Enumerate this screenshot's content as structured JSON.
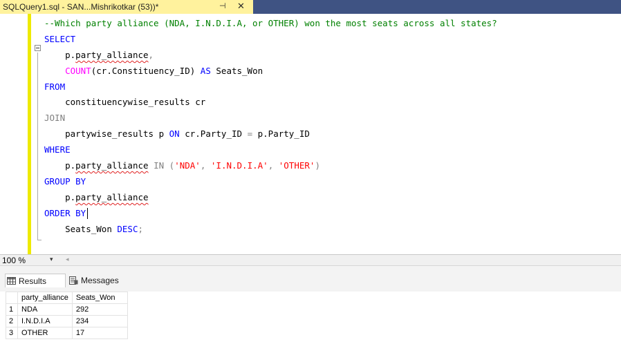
{
  "tab": {
    "title": "SQLQuery1.sql - SAN...Mishrikotkar (53))*",
    "pin_glyph": "⊣",
    "close_glyph": "✕"
  },
  "editor": {
    "comment": "--Which party alliance (NDA, I.N.D.I.A, or OTHER) won the most seats across all states?",
    "kw_select": "SELECT",
    "select_col_prefix": "p.",
    "select_col_name": "party_alliance",
    "comma": ",",
    "count_fn": "COUNT",
    "count_arg": "(cr.Constituency_ID)",
    "as_kw": "AS",
    "alias": "Seats_Won",
    "kw_from": "FROM",
    "from_table": "constituencywise_results cr",
    "kw_join": "JOIN",
    "join_table": "partywise_results p",
    "on_kw": "ON",
    "join_left": "cr.Party_ID",
    "equals": "=",
    "join_right": "p.Party_ID",
    "kw_where": "WHERE",
    "where_prefix": "p.",
    "where_col": "party_alliance",
    "in_kw": "IN",
    "paren_open": "(",
    "val1": "'NDA'",
    "sep": ",",
    "val2": "'I.N.D.I.A'",
    "val3": "'OTHER'",
    "paren_close": ")",
    "kw_group_by": "GROUP BY",
    "group_prefix": "p.",
    "group_col": "party_alliance",
    "kw_order_by": "ORDER BY",
    "order_col": "Seats_Won",
    "desc_kw": "DESC",
    "semicolon": ";"
  },
  "status": {
    "zoom": "100 %",
    "zoom_caret": "▾",
    "scroll_arrow": "◂"
  },
  "results": {
    "tab_results": "Results",
    "tab_messages": "Messages",
    "columns": [
      "party_alliance",
      "Seats_Won"
    ],
    "rows": [
      {
        "num": "1",
        "party_alliance": "NDA",
        "seats_won": "292"
      },
      {
        "num": "2",
        "party_alliance": "I.N.D.I.A",
        "seats_won": "234"
      },
      {
        "num": "3",
        "party_alliance": "OTHER",
        "seats_won": "17"
      }
    ]
  },
  "colors": {
    "tab_active": "#fff29d",
    "tabstrip": "#3f5383",
    "keyword": "#0000ff",
    "function": "#ff00ff",
    "string": "#ff0000",
    "comment": "#008000",
    "margin": "#eeea00"
  }
}
